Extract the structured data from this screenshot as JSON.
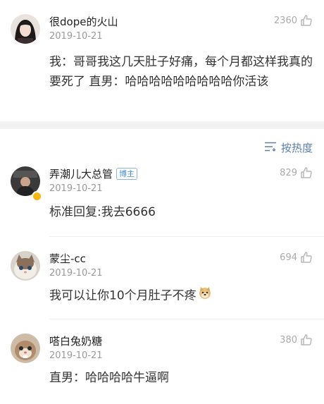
{
  "post": {
    "username": "很dope的火山",
    "date": "2019-10-21",
    "likes": "2360",
    "content": "我：哥哥我这几天肚子好痛，每个月都这样我真的要死了 直男：哈哈哈哈哈哈哈哈哈你活该"
  },
  "sort": {
    "label": "按热度",
    "icon": "sort-lines-icon"
  },
  "comments": [
    {
      "username": "弄潮儿大总管",
      "badge": "博主",
      "date": "2019-10-21",
      "likes": "829",
      "content": "标准回复:我去6666",
      "verified": true
    },
    {
      "username": "蒙尘-cc",
      "date": "2019-10-21",
      "likes": "694",
      "content": "我可以让你10个月肚子不疼",
      "emoji": "doge-emoji"
    },
    {
      "username": "嗒白兔奶糖",
      "date": "2019-10-21",
      "likes": "380",
      "content": "直男：哈哈哈哈牛逼啊"
    }
  ]
}
